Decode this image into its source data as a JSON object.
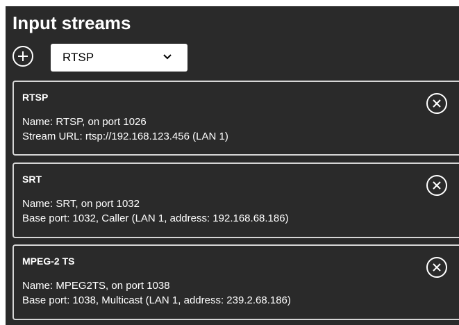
{
  "header": {
    "title": "Input streams"
  },
  "add_stream": {
    "icon": "plus-circle-icon",
    "selected_type": "RTSP",
    "chevron_icon": "chevron-down-icon"
  },
  "streams": [
    {
      "title": "RTSP",
      "name_line": "Name: RTSP, on port 1026",
      "detail_line": "Stream URL: rtsp://192.168.123.456 (LAN 1)"
    },
    {
      "title": "SRT",
      "name_line": "Name: SRT, on port 1032",
      "detail_line": "Base port: 1032, Caller (LAN 1, address: 192.168.68.186)"
    },
    {
      "title": "MPEG-2 TS",
      "name_line": "Name: MPEG2TS, on port 1038",
      "detail_line": "Base port: 1038, Multicast (LAN 1, address: 239.2.68.186)"
    }
  ],
  "colors": {
    "panel_background": "#2a2a2a",
    "card_border": "#d6d6d6",
    "text": "#ffffff",
    "select_background": "#ffffff"
  }
}
